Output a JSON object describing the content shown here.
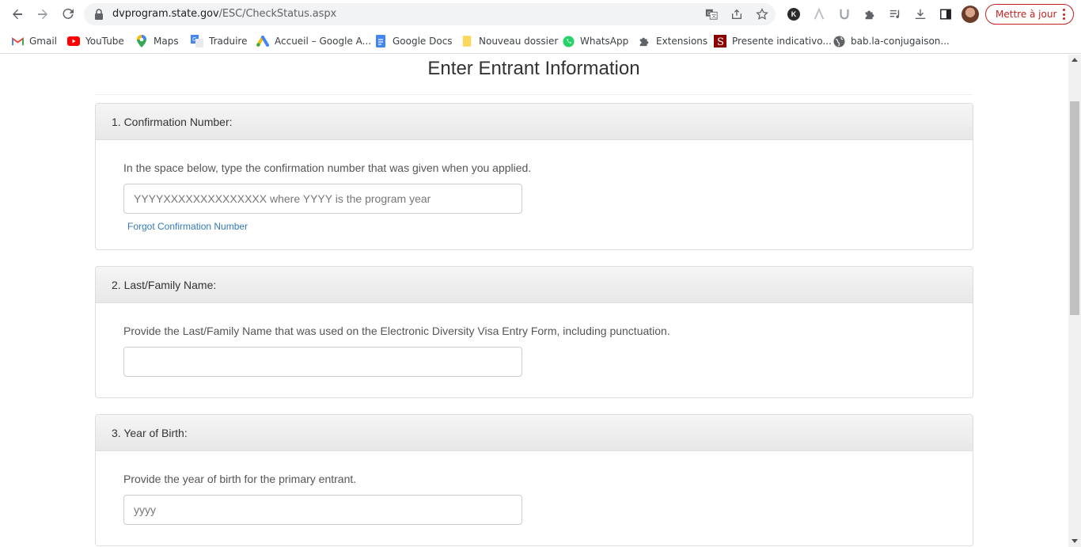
{
  "browser": {
    "url_host": "dvprogram.state.gov",
    "url_path": "/ESC/CheckStatus.aspx",
    "update_label": "Mettre à jour"
  },
  "bookmarks": [
    {
      "label": "Gmail",
      "icon": "gmail-icon"
    },
    {
      "label": "YouTube",
      "icon": "youtube-icon"
    },
    {
      "label": "Maps",
      "icon": "maps-icon"
    },
    {
      "label": "Traduire",
      "icon": "translate-icon"
    },
    {
      "label": "Accueil – Google A...",
      "icon": "google-ads-icon"
    },
    {
      "label": "Google Docs",
      "icon": "docs-icon"
    },
    {
      "label": "Nouveau dossier",
      "icon": "folder-icon"
    },
    {
      "label": "WhatsApp",
      "icon": "whatsapp-icon"
    },
    {
      "label": "Extensions",
      "icon": "puzzle-icon"
    },
    {
      "label": "Presente indicativo...",
      "icon": "s-logo-icon"
    },
    {
      "label": "bab.la-conjugaison...",
      "icon": "globe-icon"
    }
  ],
  "page": {
    "title": "Enter Entrant Information",
    "sections": [
      {
        "heading": "1. Confirmation Number:",
        "description": "In the space below, type the confirmation number that was given when you applied.",
        "placeholder": "YYYYXXXXXXXXXXXXXX where YYYY is the program year",
        "value": "",
        "link": "Forgot Confirmation Number"
      },
      {
        "heading": "2. Last/Family Name:",
        "description": "Provide the Last/Family Name that was used on the Electronic Diversity Visa Entry Form, including punctuation.",
        "placeholder": "",
        "value": ""
      },
      {
        "heading": "3. Year of Birth:",
        "description": "Provide the year of birth for the primary entrant.",
        "placeholder": "yyyy",
        "value": ""
      }
    ]
  },
  "colors": {
    "link": "#337ab7",
    "update": "#c5221f"
  }
}
